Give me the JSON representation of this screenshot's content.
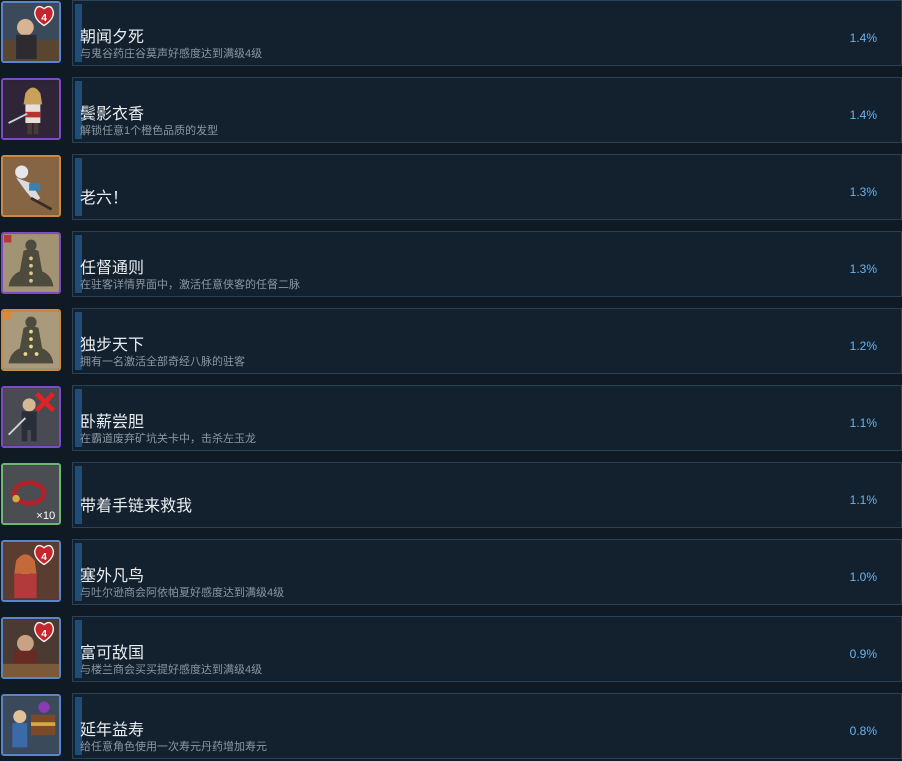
{
  "achievements": [
    {
      "title": "朝闻夕死",
      "desc": "与鬼谷药庄谷莫声好感度达到满级4级",
      "pct": "1.4%",
      "icon": "npc-affection-heart-icon",
      "frame": "blue",
      "badge": "4"
    },
    {
      "title": "鬓影衣香",
      "desc": "解锁任意1个橙色品质的发型",
      "pct": "1.4%",
      "icon": "swordswoman-hairstyle-icon",
      "frame": "purple",
      "badge": ""
    },
    {
      "title": "老六！",
      "desc": "",
      "pct": "1.3%",
      "icon": "fallen-fighter-icon",
      "frame": "orange",
      "badge": ""
    },
    {
      "title": "任督通则",
      "desc": "在驻客详情界面中，激活任意侠客的任督二脉",
      "pct": "1.3%",
      "icon": "meridian-silhouette-icon",
      "frame": "purple",
      "badge": ""
    },
    {
      "title": "独步天下",
      "desc": "拥有一名激活全部奇经八脉的驻客",
      "pct": "1.2%",
      "icon": "meridian-silhouette-gold-icon",
      "frame": "orange",
      "badge": ""
    },
    {
      "title": "卧薪尝胆",
      "desc": "在霸道废弃矿坑关卡中，击杀左玉龙",
      "pct": "1.1%",
      "icon": "defeated-boss-icon",
      "frame": "purple",
      "badge": ""
    },
    {
      "title": "带着手链来救我",
      "desc": "",
      "pct": "1.1%",
      "icon": "bead-bracelet-icon",
      "frame": "green",
      "badge": "×10"
    },
    {
      "title": "塞外凡鸟",
      "desc": "与吐尔逊商会阿依帕夏好感度达到满级4级",
      "pct": "1.0%",
      "icon": "npc-affection-heart-icon",
      "frame": "blue",
      "badge": "4"
    },
    {
      "title": "富可敌国",
      "desc": "与楼兰商会买买提好感度达到满级4级",
      "pct": "0.9%",
      "icon": "npc-affection-heart-icon",
      "frame": "blue",
      "badge": "4"
    },
    {
      "title": "延年益寿",
      "desc": "给任意角色使用一次寿元丹药增加寿元",
      "pct": "0.8%",
      "icon": "treasure-chest-icon",
      "frame": "blue",
      "badge": ""
    }
  ],
  "colors": {
    "background": "#0f1a24",
    "panel": "#13212e",
    "panel_border": "#2a4258",
    "accent_bar": "#1e4e78",
    "title": "#e8edf1",
    "description": "#8b97a1",
    "percent": "#68b4f2"
  }
}
